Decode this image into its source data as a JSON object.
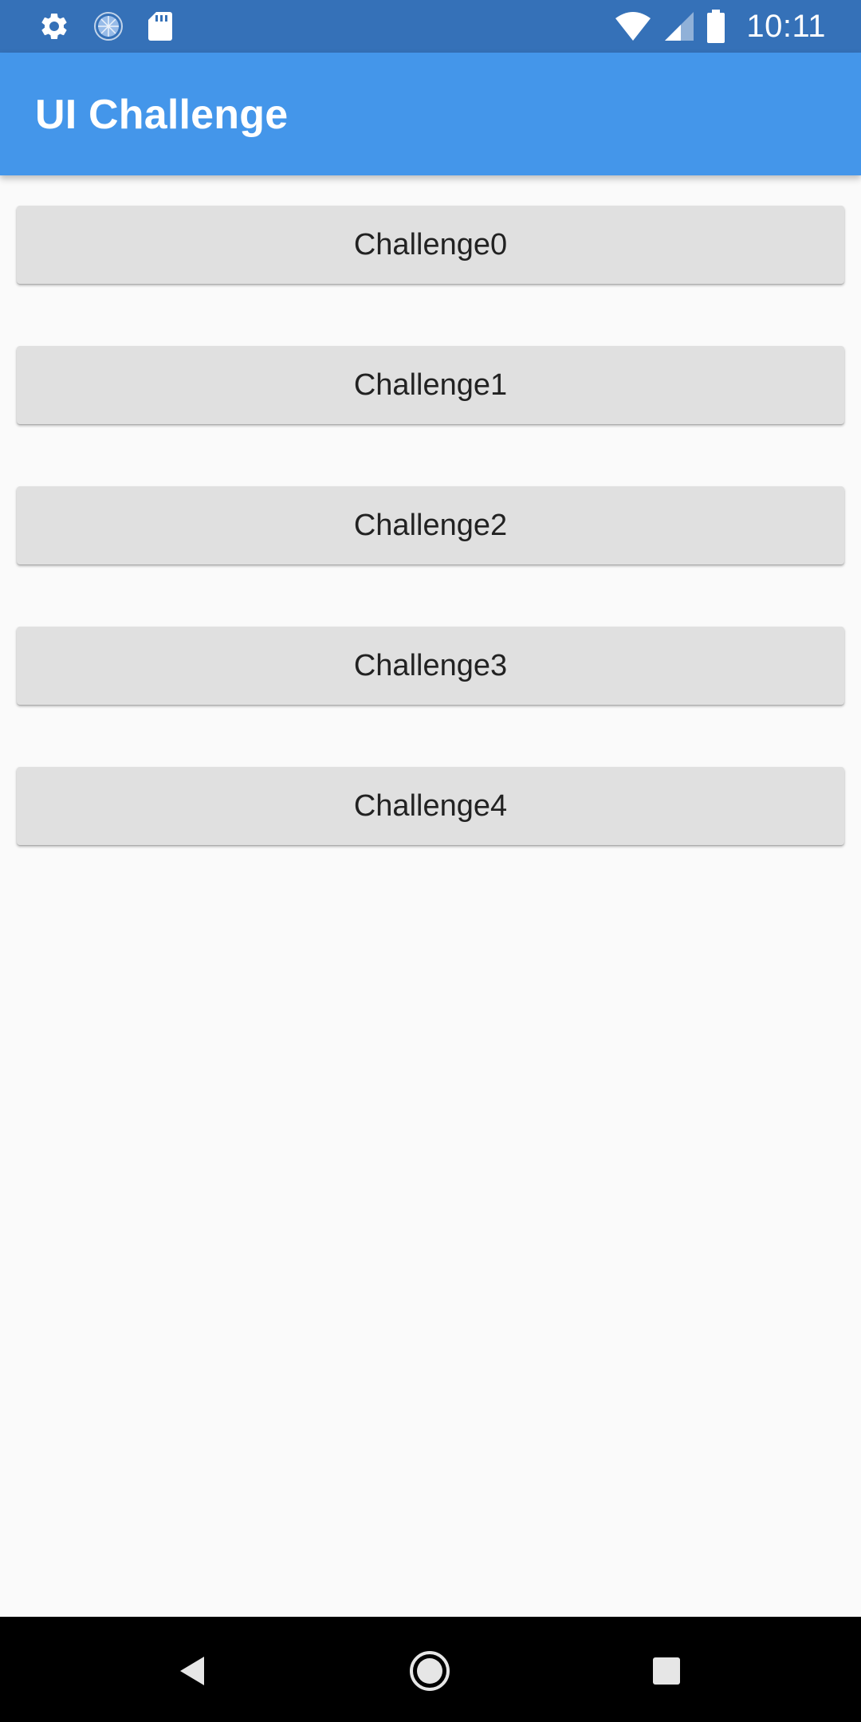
{
  "status_bar": {
    "time": "10:11",
    "left_icons": [
      "gear-icon",
      "sync-icon",
      "sd-card-icon"
    ],
    "right_icons": [
      "wifi-icon",
      "cell-signal-icon",
      "battery-icon"
    ],
    "background_color": "#3571B8"
  },
  "app_bar": {
    "title": "UI Challenge",
    "background_color": "#4496EA"
  },
  "challenges": [
    {
      "label": "Challenge0"
    },
    {
      "label": "Challenge1"
    },
    {
      "label": "Challenge2"
    },
    {
      "label": "Challenge3"
    },
    {
      "label": "Challenge4"
    }
  ],
  "nav_bar": {
    "buttons": [
      "back-icon",
      "home-icon",
      "recents-icon"
    ]
  }
}
